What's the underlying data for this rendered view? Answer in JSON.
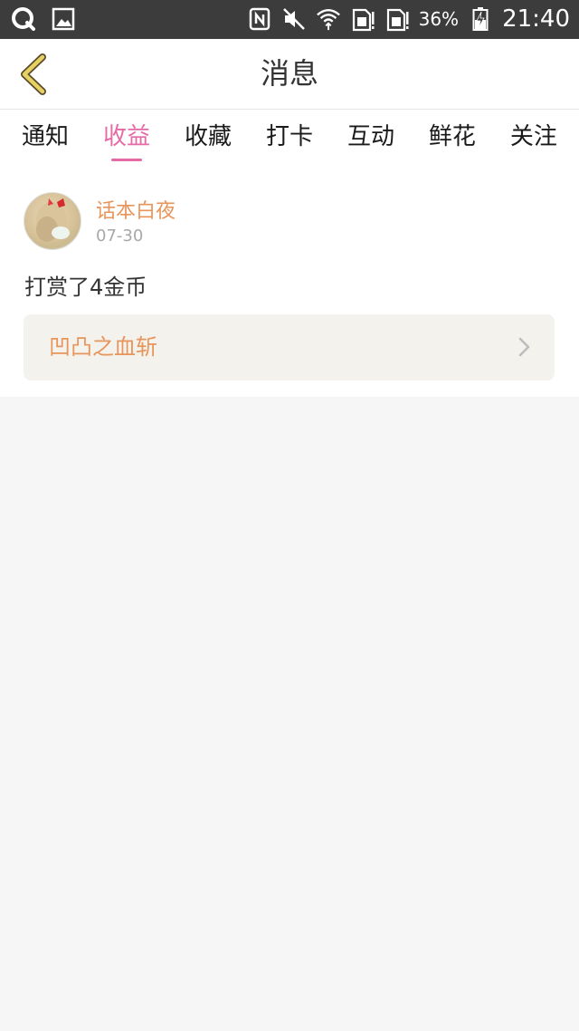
{
  "status_bar": {
    "battery": "36%",
    "time": "21:40"
  },
  "header": {
    "title": "消息"
  },
  "tabs": [
    {
      "label": "通知",
      "active": false
    },
    {
      "label": "收益",
      "active": true
    },
    {
      "label": "收藏",
      "active": false
    },
    {
      "label": "打卡",
      "active": false
    },
    {
      "label": "互动",
      "active": false
    },
    {
      "label": "鲜花",
      "active": false
    },
    {
      "label": "关注",
      "active": false
    }
  ],
  "message": {
    "user_name": "话本白夜",
    "date": "07-30",
    "text": "打赏了4金币",
    "work_title": "凹凸之血斩"
  },
  "colors": {
    "accent_pink": "#e56aa5",
    "accent_orange": "#e8955b",
    "back_icon": "#e6d264"
  }
}
